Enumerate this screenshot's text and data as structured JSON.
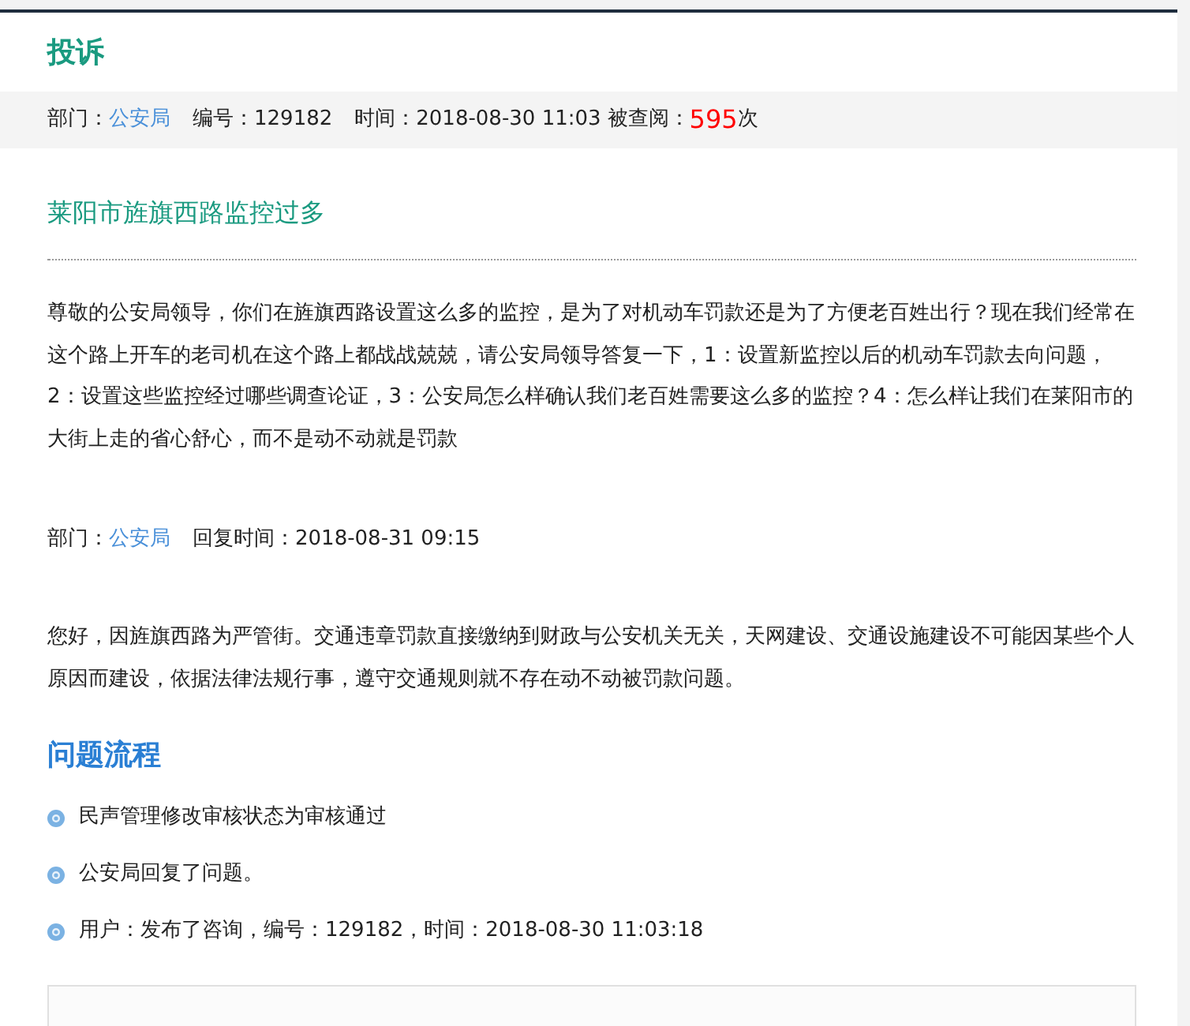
{
  "header": {
    "title": "投诉"
  },
  "meta": {
    "dept_label": "部门：",
    "dept": "公安局",
    "number": "编号：129182",
    "time": "时间：2018-08-30 11:03",
    "views_label": "被查阅：",
    "views": "595",
    "views_unit": "次"
  },
  "subject": "莱阳市旌旗西路监控过多",
  "body": "尊敬的公安局领导，你们在旌旗西路设置这么多的监控，是为了对机动车罚款还是为了方便老百姓出行？现在我们经常在这个路上开车的老司机在这个路上都战战兢兢，请公安局领导答复一下，1：设置新监控以后的机动车罚款去向问题，2：设置这些监控经过哪些调查论证，3：公安局怎么样确认我们老百姓需要这么多的监控？4：怎么样让我们在莱阳市的大街上走的省心舒心，而不是动不动就是罚款",
  "reply_meta": {
    "dept_label": "部门：",
    "dept": "公安局",
    "time": "回复时间：2018-08-31 09:15"
  },
  "reply": "您好，因旌旗西路为严管街。交通违章罚款直接缴纳到财政与公安机关无关，天网建设、交通设施建设不可能因某些个人原因而建设，依据法律法规行事，遵守交通规则就不存在动不动被罚款问题。",
  "process": {
    "title": "问题流程",
    "steps": [
      "民声管理修改审核状态为审核通过",
      "公安局回复了问题。",
      "用户：发布了咨询，编号：129182，时间：2018-08-30 11:03:18"
    ]
  }
}
